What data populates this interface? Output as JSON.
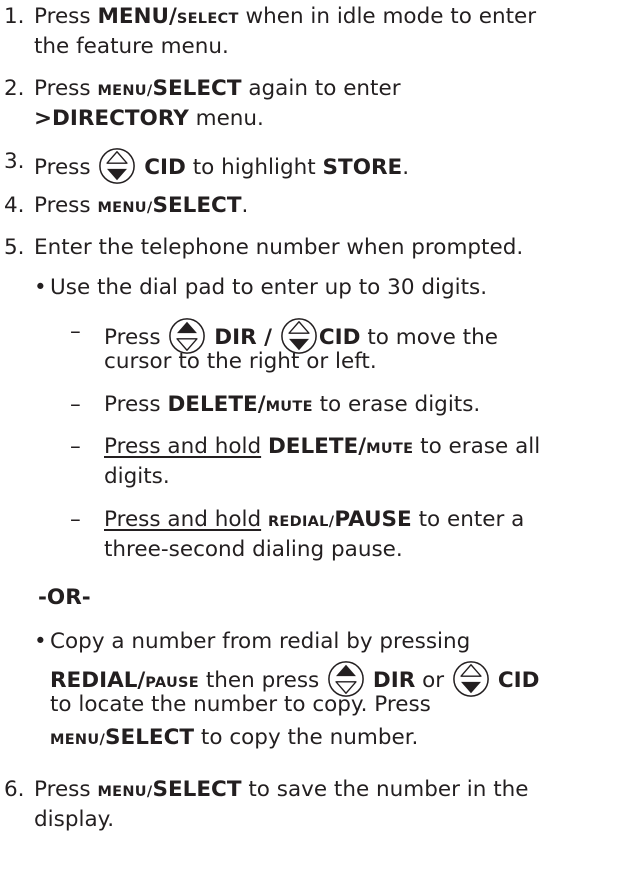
{
  "steps": [
    {
      "num": "1.",
      "press": "Press",
      "menu_select_bold": "MENU/",
      "menu_select_sc": "SELECT",
      "rest": "when in idle mode to enter",
      "line2": "the feature menu."
    },
    {
      "num": "2.",
      "press": "Press",
      "menu_sc": "MENU/",
      "select_bold": "SELECT",
      "rest": "again to enter",
      "line2_bold": ">DIRECTORY",
      "line2_rest": "menu."
    },
    {
      "num": "3.",
      "press": "Press",
      "cid": "CID",
      "rest": "to highlight",
      "store": "STORE",
      "end": "."
    },
    {
      "num": "4.",
      "press": "Press",
      "menu_sc": "MENU/",
      "select_bold": "SELECT",
      "end": "."
    },
    {
      "num": "5.",
      "text": "Enter the telephone number when prompted."
    },
    {
      "num": "6.",
      "press": "Press",
      "menu_sc": "MENU/",
      "select_bold": "SELECT",
      "rest": "to save the number in the",
      "line2": "display."
    }
  ],
  "bullets": [
    {
      "mark": "•",
      "text": "Use the dial pad to enter up to 30 digits."
    },
    {
      "mark": "•",
      "line1_a": "Copy a number from redial by pressing",
      "redial_bold": "REDIAL/",
      "pause_sc": "PAUSE",
      "then_press": "then press",
      "dir": "DIR",
      "or": "or",
      "cid": "CID",
      "line3": "to locate the number to copy. Press",
      "menu_sc": "MENU/",
      "select_bold": "SELECT",
      "line4_rest": "to copy the number."
    }
  ],
  "dashes": [
    {
      "mark": "–",
      "press": "Press",
      "dir": "DIR /",
      "cid": "CID",
      "rest": "to move the",
      "line2": "cursor to the right or left."
    },
    {
      "mark": "–",
      "press": "Press",
      "delete_bold": "DELETE/",
      "mute_sc": "MUTE",
      "rest": "to erase digits."
    },
    {
      "mark": "–",
      "hold": "Press and hold",
      "delete_bold": "DELETE/",
      "mute_sc": "MUTE",
      "rest": "to erase all",
      "line2": "digits."
    },
    {
      "mark": "–",
      "hold": "Press and hold",
      "redial_sc": "REDIAL/",
      "pause_bold": "PAUSE",
      "rest": "to enter a",
      "line2": "three-second dialing pause."
    }
  ],
  "or_separator": "-OR-",
  "icons": {
    "down": "down-arrow-key-icon",
    "up": "up-arrow-key-icon"
  }
}
